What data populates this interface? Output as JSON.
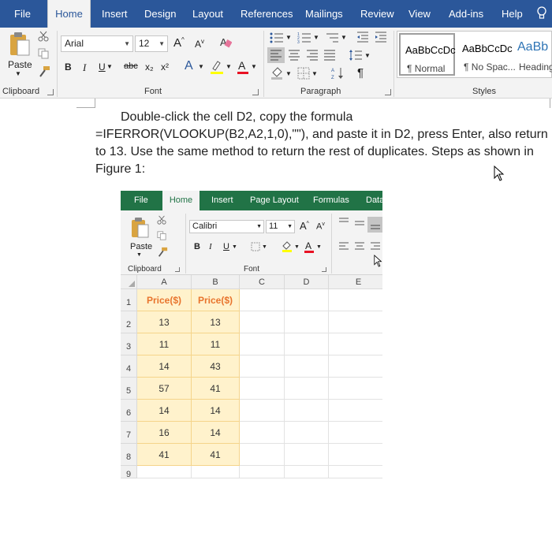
{
  "word": {
    "tabs": [
      "File",
      "Home",
      "Insert",
      "Design",
      "Layout",
      "References",
      "Mailings",
      "Review",
      "View",
      "Add-ins",
      "Help"
    ],
    "active_tab": "Home",
    "clipboard": {
      "paste_label": "Paste",
      "group_label": "Clipboard"
    },
    "font": {
      "name": "Arial",
      "size": "12",
      "group_label": "Font",
      "bold": "B",
      "italic": "I",
      "underline": "U",
      "strike": "abc",
      "subscript": "x₂",
      "superscript": "x²",
      "highlight_color": "#ffff00",
      "font_color": "#e81123"
    },
    "paragraph": {
      "group_label": "Paragraph",
      "pilcrow": "¶"
    },
    "styles": {
      "group_label": "Styles",
      "items": [
        {
          "sample": "AaBbCcDc",
          "name": "¶ Normal"
        },
        {
          "sample": "AaBbCcDc",
          "name": "¶ No Spac..."
        },
        {
          "sample": "AaBb",
          "name": "Heading"
        }
      ]
    }
  },
  "document": {
    "paragraph": [
      "Double-click the cell D2, copy the formula",
      "=IFERROR(VLOOKUP(B2,A2,1,0),\"\"), and paste it in D2, press Enter, also return",
      "to 13. Use the same method to return the rest of duplicates. Steps as shown in",
      "Figure 1:"
    ]
  },
  "excel": {
    "tabs": [
      "File",
      "Home",
      "Insert",
      "Page Layout",
      "Formulas",
      "Data"
    ],
    "active_tab": "Home",
    "clipboard": {
      "paste_label": "Paste",
      "group_label": "Clipboard"
    },
    "font": {
      "name": "Calibri",
      "size": "11",
      "group_label": "Font",
      "bold": "B",
      "italic": "I",
      "underline": "U"
    },
    "columns": [
      "A",
      "B",
      "C",
      "D",
      "E"
    ],
    "rows": [
      "1",
      "2",
      "3",
      "4",
      "5",
      "6",
      "7",
      "8",
      "9"
    ],
    "headers": [
      "Price($)",
      "Price($)"
    ],
    "col_a": [
      "13",
      "11",
      "14",
      "57",
      "14",
      "16",
      "41"
    ],
    "col_b": [
      "13",
      "11",
      "43",
      "41",
      "14",
      "14",
      "41"
    ]
  },
  "colors": {
    "word_blue": "#2b579a",
    "excel_green": "#217346",
    "cell_highlight": "#fff2cc",
    "header_orange": "#e8742d"
  }
}
